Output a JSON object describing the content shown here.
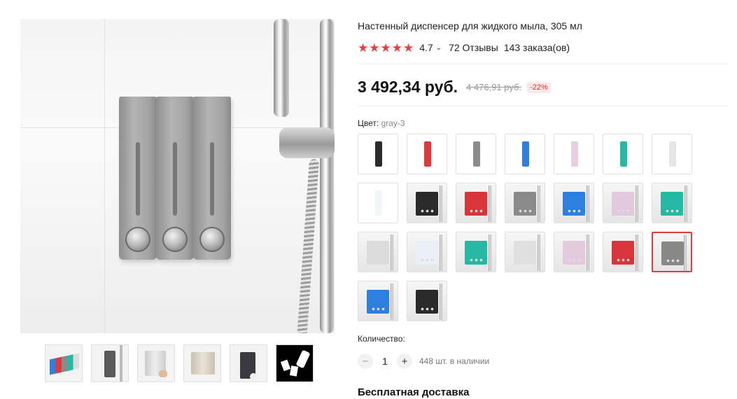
{
  "product": {
    "title": "Настенный диспенсер для жидкого мыла, 305 мл",
    "rating": {
      "stars": "★★★★★",
      "value": "4.7",
      "reviews": "72 Отзывы",
      "orders": "143 заказа(ов)"
    },
    "price": "3 492,34 руб.",
    "old_price": "4 476,91 руб.",
    "discount": "-22%"
  },
  "color": {
    "label": "Цвет:",
    "selected": "gray-3",
    "swatches": [
      {
        "name": "black-1",
        "color": "#2a2a2a",
        "style": "single"
      },
      {
        "name": "red-1",
        "color": "#e0383e",
        "style": "single"
      },
      {
        "name": "gray-1",
        "color": "#8c8c8c",
        "style": "single"
      },
      {
        "name": "blue-1",
        "color": "#2f7fe0",
        "style": "single"
      },
      {
        "name": "pink-1",
        "color": "#e7cfe2",
        "style": "single"
      },
      {
        "name": "teal-1",
        "color": "#27b8a4",
        "style": "single"
      },
      {
        "name": "white-1",
        "color": "#e6e6e6",
        "style": "single"
      },
      {
        "name": "clear-1",
        "color": "#f2f6fb",
        "style": "single"
      },
      {
        "name": "black-2",
        "color": "#2a2a2a",
        "style": "scene"
      },
      {
        "name": "red-2",
        "color": "#d9343a",
        "style": "scene"
      },
      {
        "name": "gray-2",
        "color": "#8a8a8a",
        "style": "scene"
      },
      {
        "name": "blue-2",
        "color": "#2d7fe0",
        "style": "scene"
      },
      {
        "name": "pink-2",
        "color": "#e2c9dd",
        "style": "scene"
      },
      {
        "name": "teal-2",
        "color": "#27b8a4",
        "style": "scene"
      },
      {
        "name": "white-3",
        "color": "#dcdcdc",
        "style": "scene"
      },
      {
        "name": "clear-3",
        "color": "#eaf0f7",
        "style": "scene"
      },
      {
        "name": "teal-3",
        "color": "#27b8a4",
        "style": "scene"
      },
      {
        "name": "white-3b",
        "color": "#e0e0e0",
        "style": "scene"
      },
      {
        "name": "pink-3",
        "color": "#e3cadd",
        "style": "scene"
      },
      {
        "name": "red-3",
        "color": "#d9343a",
        "style": "scene"
      },
      {
        "name": "gray-3",
        "color": "#888888",
        "style": "scene",
        "selected": true
      },
      {
        "name": "blue-3",
        "color": "#2d7fe0",
        "style": "scene"
      },
      {
        "name": "black-3",
        "color": "#2a2a2a",
        "style": "scene"
      }
    ]
  },
  "quantity": {
    "label": "Количество:",
    "minus": "−",
    "value": "1",
    "plus": "+",
    "stock": "448 шт. в наличии"
  },
  "delivery": {
    "title": "Бесплатная доставка"
  },
  "thumbnails": [
    {
      "name": "thumb-multicolor"
    },
    {
      "name": "thumb-single"
    },
    {
      "name": "thumb-triple-white"
    },
    {
      "name": "thumb-triple-beige"
    },
    {
      "name": "thumb-double-black"
    },
    {
      "name": "thumb-installation"
    }
  ],
  "accent_color": "#e33a3a"
}
